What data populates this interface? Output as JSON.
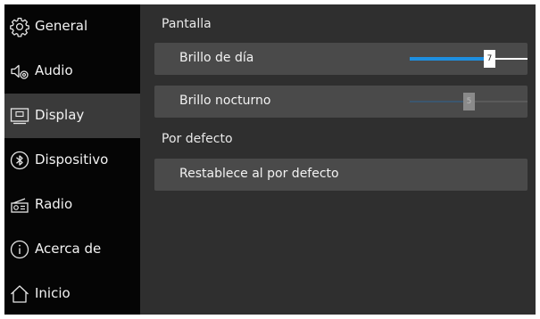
{
  "sidebar": {
    "items": [
      {
        "label": "General",
        "icon": "gear-icon"
      },
      {
        "label": "Audio",
        "icon": "speaker-settings-icon"
      },
      {
        "label": "Display",
        "icon": "display-icon",
        "active": true
      },
      {
        "label": "Dispositivo",
        "icon": "bluetooth-icon"
      },
      {
        "label": "Radio",
        "icon": "radio-icon"
      },
      {
        "label": "Acerca de",
        "icon": "info-icon"
      },
      {
        "label": "Inicio",
        "icon": "home-icon"
      }
    ]
  },
  "main": {
    "screen_section": {
      "title": "Pantalla"
    },
    "day_brightness": {
      "label": "Brillo de día",
      "value": "7",
      "value_fraction": 0.7,
      "enabled": true
    },
    "night_brightness": {
      "label": "Brillo nocturno",
      "value": "5",
      "value_fraction": 0.5,
      "enabled": false
    },
    "defaults_section": {
      "title": "Por defecto"
    },
    "reset_button": {
      "label": "Restablece al por defecto"
    }
  },
  "colors": {
    "background": "#2f2f2f",
    "sidebar": "#050505",
    "active_item": "#3a3a3a",
    "row": "#4a4a4a",
    "slider_accent": "#1e8fe0"
  }
}
